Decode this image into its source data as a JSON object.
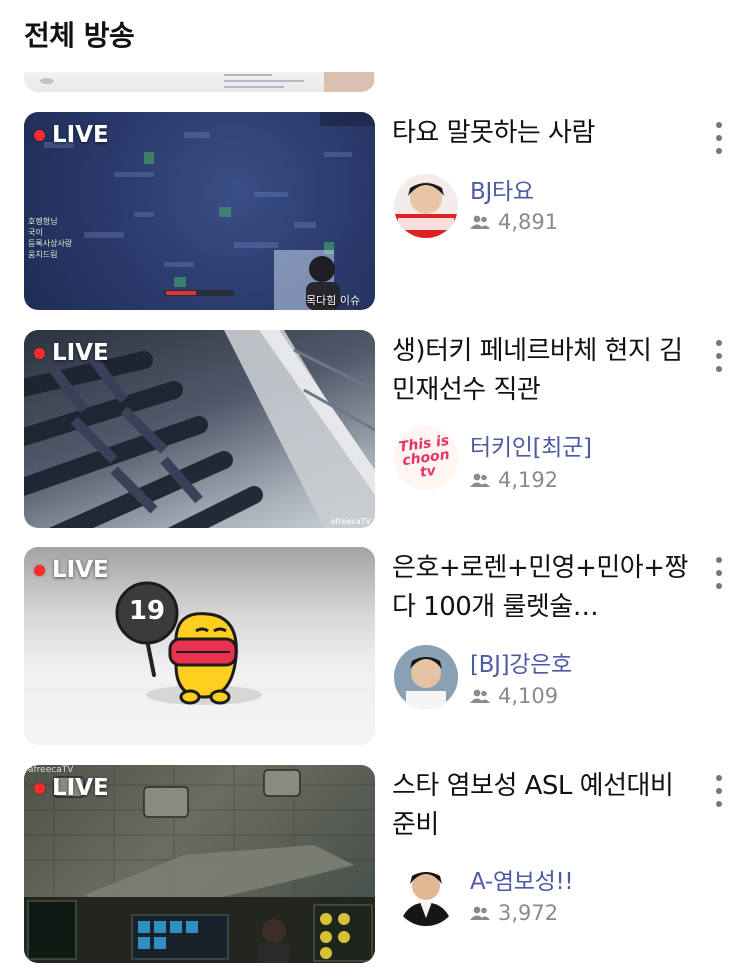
{
  "section": {
    "title": "전체 방송"
  },
  "badge": {
    "live": "LIVE"
  },
  "streams": [
    {
      "title": "타요 말못하는 사람",
      "bj": "BJ타요",
      "viewers": "4,891",
      "overlay_caption": "목다힘 이슈",
      "overlay_chat": [
        "호렝형님",
        "국이",
        "등록사상사랑",
        "움치드림"
      ]
    },
    {
      "title": "생)터키 페네르바체 현지 김민재선수 직관",
      "bj": "터키인[최군]",
      "viewers": "4,192",
      "logo_text": "This is choon tv"
    },
    {
      "title": "은호+로렌+민영+민아+짱다 100개 룰렛술…",
      "bj": "[BJ]강은호",
      "viewers": "4,109",
      "sign_text": "19"
    },
    {
      "title": "스타 염보성 ASL 예선대비 준비",
      "bj": "A-염보성!!",
      "viewers": "3,972"
    }
  ],
  "watermark": "afreecaTV",
  "colors": {
    "live_dot": "#ff2b2b",
    "bj_name": "#4e5aa6",
    "meta": "#8a8a8a"
  }
}
